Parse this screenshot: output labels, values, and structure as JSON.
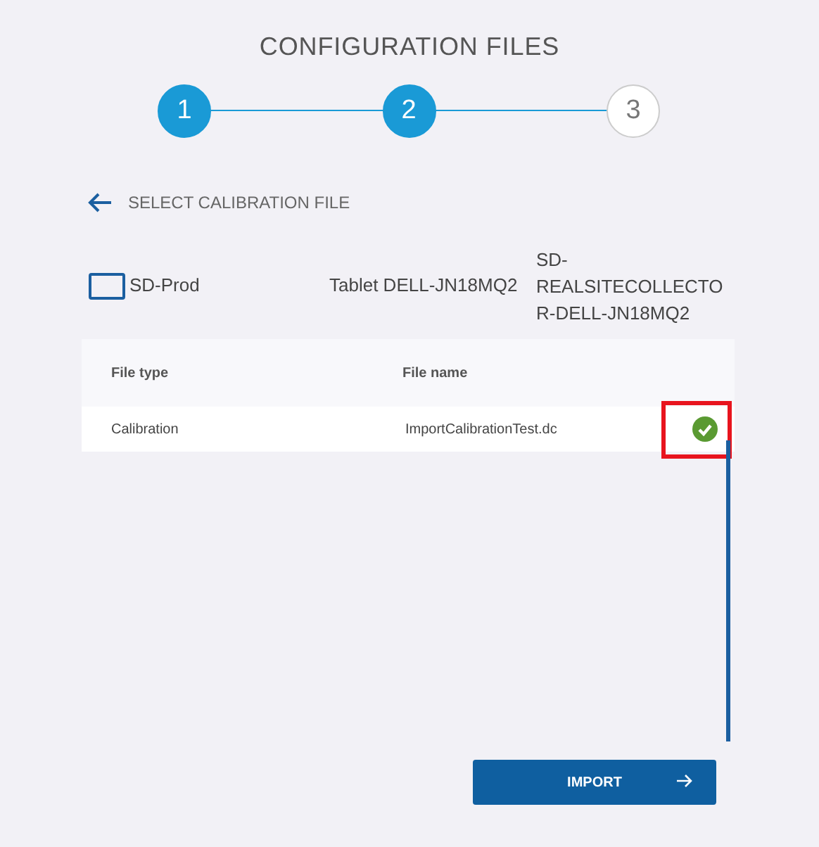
{
  "title": "CONFIGURATION FILES",
  "steps": [
    {
      "label": "1",
      "active": true
    },
    {
      "label": "2",
      "active": true
    },
    {
      "label": "3",
      "active": false
    }
  ],
  "section": {
    "title": "SELECT CALIBRATION FILE"
  },
  "device": {
    "name": "SD-Prod",
    "tablet": "Tablet DELL-JN18MQ2",
    "collector": "SD-REALSITECOLLECTOR-DELL-JN18MQ2"
  },
  "table": {
    "columns": [
      "File type",
      "File name"
    ],
    "rows": [
      {
        "cells": [
          "Calibration",
          "ImportCalibrationTest.dc"
        ],
        "valid": true,
        "highlighted": true
      }
    ]
  },
  "button": {
    "label": "IMPORT"
  }
}
